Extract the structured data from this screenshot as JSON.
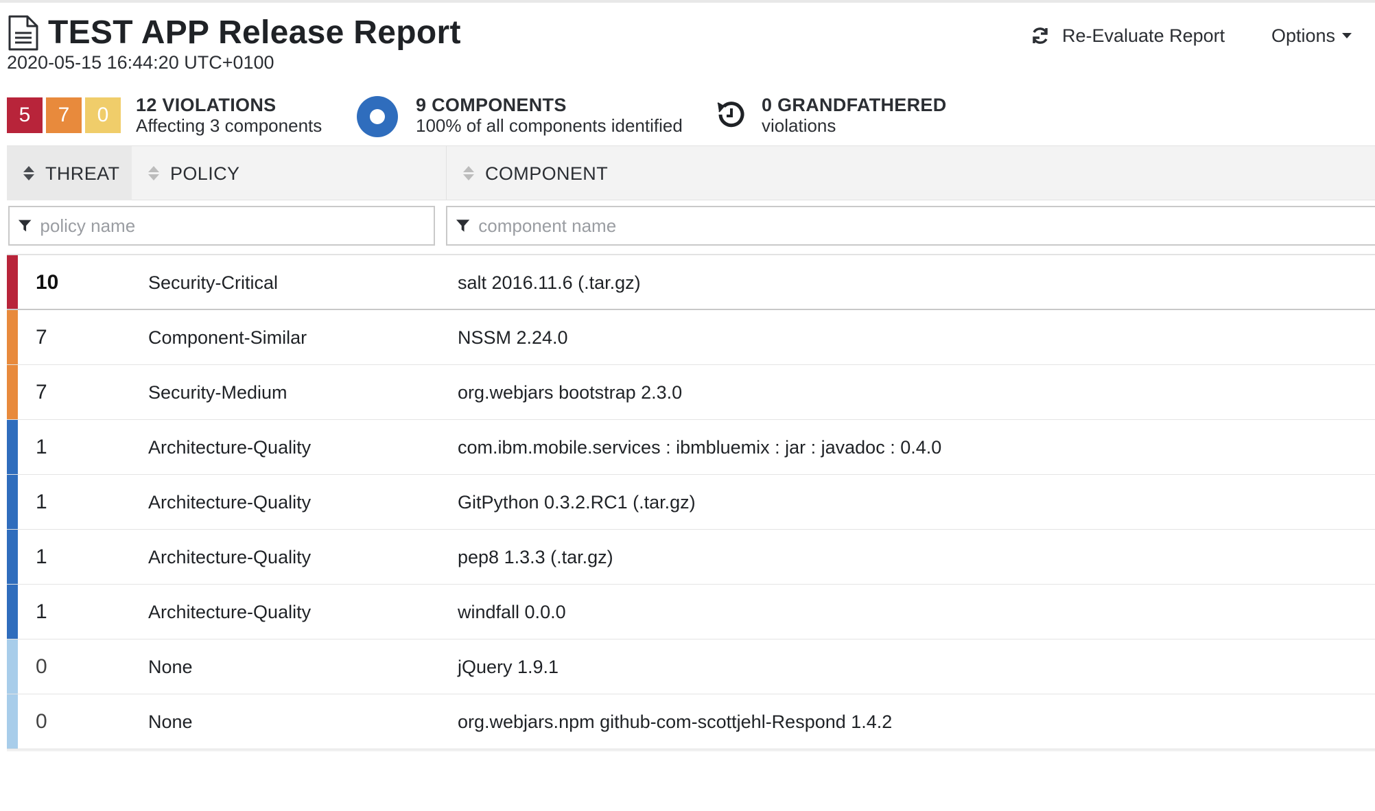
{
  "header": {
    "title": "TEST APP Release Report",
    "timestamp": "2020-05-15 16:44:20 UTC+0100",
    "reevaluate_label": "Re-Evaluate Report",
    "options_label": "Options"
  },
  "summary": {
    "counts": {
      "critical": "5",
      "severe": "7",
      "moderate": "0"
    },
    "violations_title": "12 VIOLATIONS",
    "violations_sub": "Affecting 3 components",
    "components_title": "9 COMPONENTS",
    "components_sub": "100% of all components identified",
    "grandfathered_title": "0 GRANDFATHERED",
    "grandfathered_sub": "violations"
  },
  "table": {
    "columns": {
      "threat": "THREAT",
      "policy": "POLICY",
      "component": "COMPONENT"
    },
    "filters": {
      "policy_placeholder": "policy name",
      "component_placeholder": "component name"
    },
    "rows": [
      {
        "threat": "10",
        "policy": "Security-Critical",
        "component": "salt 2016.11.6 (.tar.gz)",
        "level": "critical"
      },
      {
        "threat": "7",
        "policy": "Component-Similar",
        "component": "NSSM 2.24.0",
        "level": "severe"
      },
      {
        "threat": "7",
        "policy": "Security-Medium",
        "component": "org.webjars bootstrap 2.3.0",
        "level": "severe"
      },
      {
        "threat": "1",
        "policy": "Architecture-Quality",
        "component": "com.ibm.mobile.services : ibmbluemix : jar : javadoc : 0.4.0",
        "level": "low"
      },
      {
        "threat": "1",
        "policy": "Architecture-Quality",
        "component": "GitPython 0.3.2.RC1 (.tar.gz)",
        "level": "low"
      },
      {
        "threat": "1",
        "policy": "Architecture-Quality",
        "component": "pep8 1.3.3 (.tar.gz)",
        "level": "low"
      },
      {
        "threat": "1",
        "policy": "Architecture-Quality",
        "component": "windfall 0.0.0",
        "level": "low"
      },
      {
        "threat": "0",
        "policy": "None",
        "component": "jQuery 1.9.1",
        "level": "none"
      },
      {
        "threat": "0",
        "policy": "None",
        "component": "org.webjars.npm github-com-scottjehl-Respond 1.4.2",
        "level": "none"
      }
    ]
  },
  "colors": {
    "critical": "#b8243a",
    "severe": "#e88a3c",
    "moderate": "#f0cd6a",
    "low": "#2f6dbd",
    "none": "#a8cdea"
  },
  "icons": {
    "document": "document-icon",
    "refresh": "refresh-icon",
    "components": "components-ring-icon",
    "history": "history-icon",
    "filter": "filter-funnel-icon",
    "sort": "sort-icon"
  }
}
